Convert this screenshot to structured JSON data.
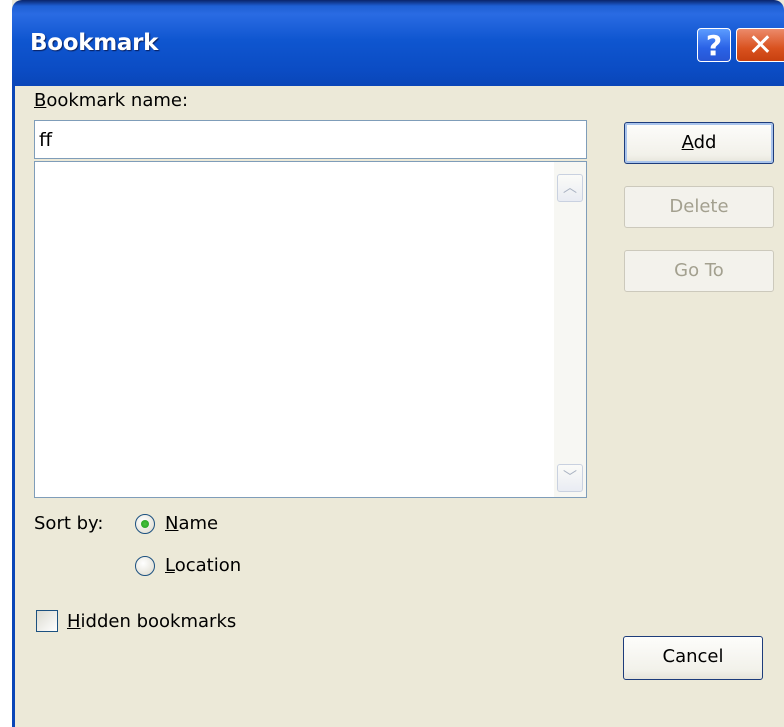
{
  "window": {
    "title": "Bookmark",
    "help_label": "?",
    "close_label": "✕"
  },
  "form": {
    "name_label": {
      "mnemonic": "B",
      "rest": "ookmark name:"
    },
    "name_value": "ff",
    "bookmarks": [],
    "sort_label": "Sort by:",
    "sort_options": [
      {
        "mnemonic": "N",
        "rest": "ame",
        "selected": true
      },
      {
        "mnemonic": "L",
        "rest": "ocation",
        "selected": false
      }
    ],
    "hidden_label": {
      "mnemonic": "H",
      "rest": "idden bookmarks",
      "checked": false
    }
  },
  "buttons": {
    "add": {
      "mnemonic": "A",
      "rest": "dd",
      "enabled": true
    },
    "delete": {
      "label": "Delete",
      "enabled": false
    },
    "goto": {
      "label": "Go To",
      "enabled": false
    },
    "cancel": {
      "label": "Cancel",
      "enabled": true
    }
  },
  "scrollbar": {
    "up_icon": "scroll-up-arrow",
    "down_icon": "scroll-down-arrow"
  },
  "colors": {
    "title_bar": "#0a46b8",
    "dialog_bg": "#ece9d8",
    "close_button": "#d9521f",
    "radio_dot": "#21a121"
  }
}
